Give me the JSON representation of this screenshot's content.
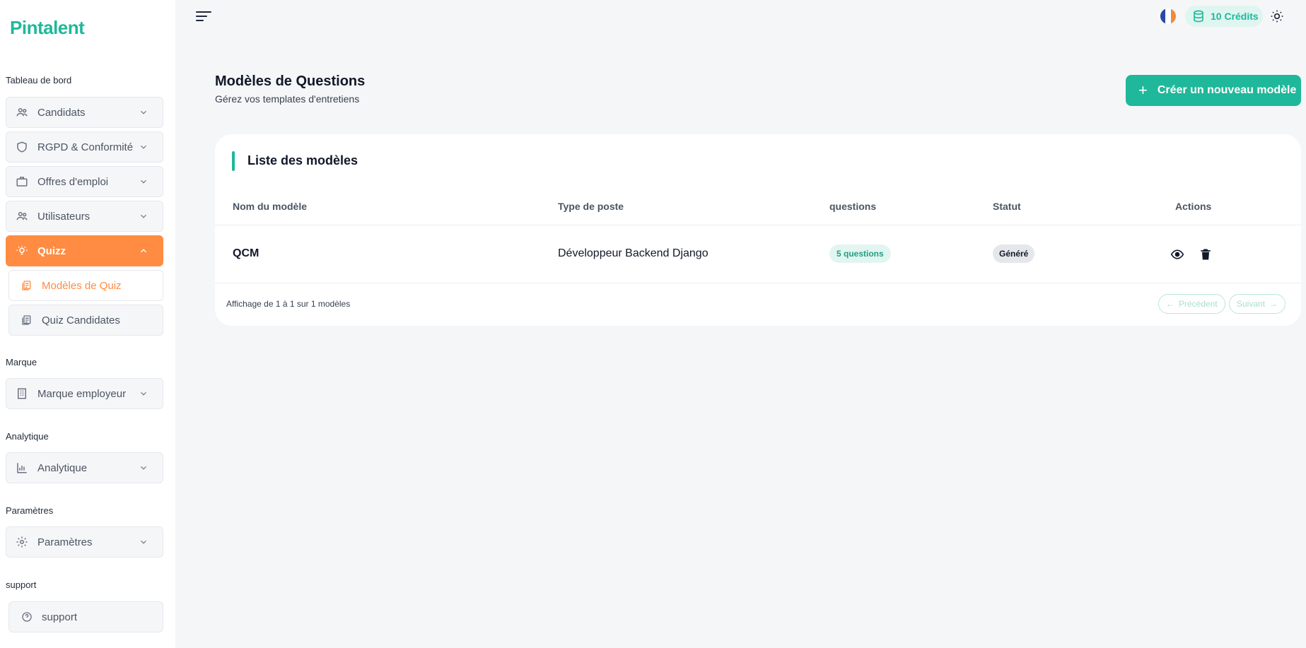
{
  "brand": {
    "name_part1": "Pint",
    "name_part2": "ale",
    "name_part3": "nt"
  },
  "sidebar": {
    "sections": {
      "dashboard": "Tableau de bord",
      "brand": "Marque",
      "analytics": "Analytique",
      "settings": "Paramètres",
      "support": "support"
    },
    "items": [
      {
        "label": "Candidats",
        "icon": "users-icon"
      },
      {
        "label": "RGPD & Conformité",
        "icon": "shield-icon"
      },
      {
        "label": "Offres d'emploi",
        "icon": "briefcase-icon"
      },
      {
        "label": "Utilisateurs",
        "icon": "users-icon"
      },
      {
        "label": "Quizz",
        "icon": "lightbulb-icon",
        "active": true
      },
      {
        "label": "Marque employeur",
        "icon": "building-icon"
      },
      {
        "label": "Analytique",
        "icon": "bar-chart-icon"
      },
      {
        "label": "Paramètres",
        "icon": "gear-icon"
      },
      {
        "label": "support",
        "icon": "help-circle-icon"
      }
    ],
    "quiz_sub": [
      {
        "label": "Modèles de Quiz",
        "active": true
      },
      {
        "label": "Quiz Candidates"
      }
    ]
  },
  "topbar": {
    "credits": "10 Crédits"
  },
  "page": {
    "title": "Modèles de Questions",
    "subtitle": "Gérez vos templates d'entretiens",
    "create_button": "Créer un nouveau modèle"
  },
  "table": {
    "title": "Liste des modèles",
    "columns": [
      "Nom du modèle",
      "Type de poste",
      "questions",
      "Statut",
      "Actions"
    ],
    "rows": [
      {
        "name": "QCM",
        "job_type": "Développeur Backend Django",
        "questions": "5 questions",
        "status": "Généré"
      }
    ],
    "pagination": {
      "info": "Affichage de 1 à 1 sur 1 modèles",
      "prev": "Précédent",
      "next": "Suivant"
    }
  },
  "colors": {
    "accent_green": "#1fb89a",
    "accent_orange": "#ff8c42",
    "background": "#f5f6f8"
  }
}
